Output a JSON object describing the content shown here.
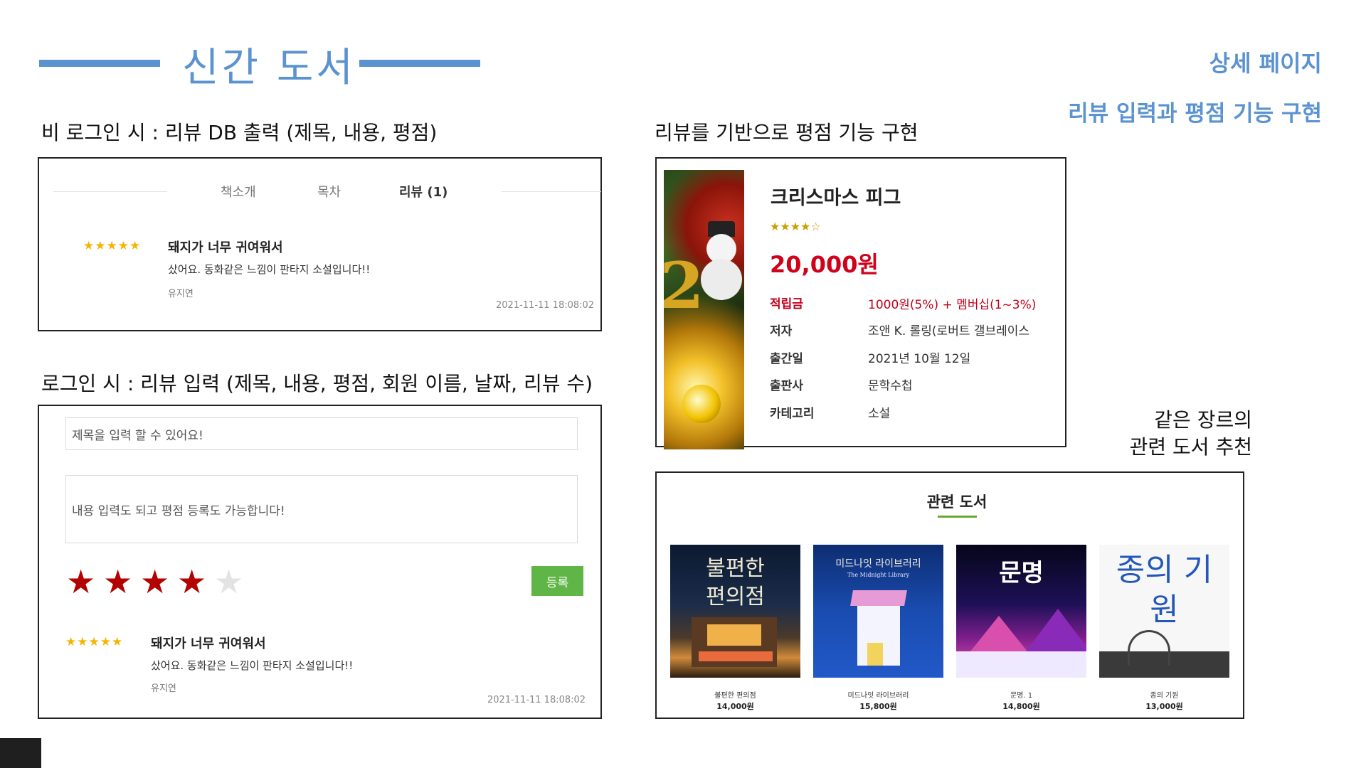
{
  "header": {
    "title": "신간 도서",
    "top_right_1": "상세 페이지",
    "top_right_2": "리뷰 입력과 평점 기능 구현"
  },
  "labels": {
    "nonlogin": "비 로그인 시 : 리뷰 DB 출력 (제목, 내용, 평점)",
    "login": "로그인 시 : 리뷰 입력 (제목, 내용, 평점, 회원 이름, 날짜, 리뷰 수)",
    "rating_based": "리뷰를 기반으로 평점 기능 구현",
    "related_note_1": "같은 장르의",
    "related_note_2": "관련 도서 추천"
  },
  "tabs": [
    {
      "label": "책소개"
    },
    {
      "label": "목차"
    },
    {
      "label": "리뷰 (1)"
    }
  ],
  "review": {
    "stars": "★★★★★",
    "title": "돼지가 너무 귀여워서",
    "body": "샀어요. 동화같은 느낌이 판타지 소설입니다!!",
    "author": "유지연",
    "date": "2021-11-11 18:08:02"
  },
  "form": {
    "title_placeholder": "제목을 입력 할 수 있어요!",
    "content_placeholder": "내용 입력도 되고 평점 등록도 가능합니다!",
    "rating": 4,
    "rating_max": 5,
    "submit_label": "등록"
  },
  "book": {
    "title": "크리스마스 피그",
    "stars": "★★★★☆",
    "price": "20,000원",
    "info": [
      {
        "key": "적립금",
        "value": "1000원(5%) + 멤버십(1~3%)",
        "highlight": true
      },
      {
        "key": "저자",
        "value": "조앤 K. 롤링(로버트 갤브레이스"
      },
      {
        "key": "출간일",
        "value": "2021년 10월 12일"
      },
      {
        "key": "출판사",
        "value": "문학수첩"
      },
      {
        "key": "카테고리",
        "value": "소설"
      }
    ]
  },
  "related": {
    "heading": "관련 도서",
    "books": [
      {
        "name": "불편한 편의점",
        "price": "14,000원",
        "cover_text": "불편한 편의점"
      },
      {
        "name": "미드나잇 라이브러리",
        "price": "15,800원",
        "cover_text": "미드나잇 라이브러리",
        "cover_sub": "The Midnight Library"
      },
      {
        "name": "문명. 1",
        "price": "14,800원",
        "cover_text": "문명"
      },
      {
        "name": "종의 기원",
        "price": "13,000원",
        "cover_text": "종의 기원"
      }
    ]
  },
  "colors": {
    "accent_blue": "#5b93d0",
    "star_yellow": "#f6b400",
    "star_red": "#b30000",
    "price_red": "#d0021b",
    "button_green": "#5fb545",
    "underline_green": "#6aa632"
  }
}
